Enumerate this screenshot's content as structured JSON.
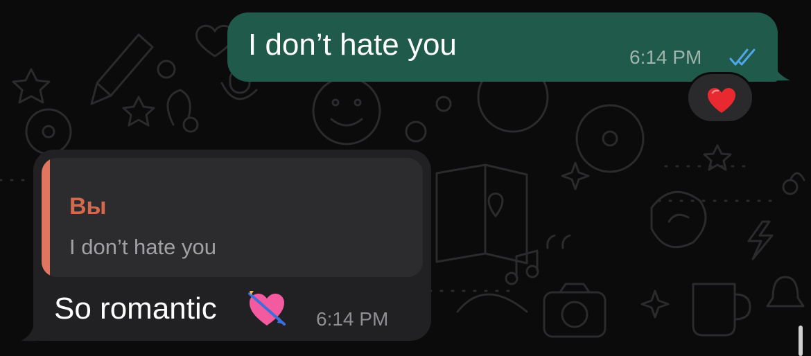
{
  "theme": {
    "background": "#0b0b0c",
    "outgoing_bubble": "#1f5a4a",
    "incoming_bubble": "#212123",
    "quote_accent": "#e07660",
    "read_ticks": "#4fa6e8"
  },
  "messages": {
    "outgoing": {
      "text": "I don’t hate you",
      "time": "6:14 PM",
      "status_icon": "double-check-read-icon",
      "reaction": "red-heart"
    },
    "incoming": {
      "reply": {
        "author": "Вы",
        "text": "I don’t hate you"
      },
      "text": "So romantic",
      "emoji": "heart-with-arrow",
      "time": "6:14 PM"
    }
  }
}
